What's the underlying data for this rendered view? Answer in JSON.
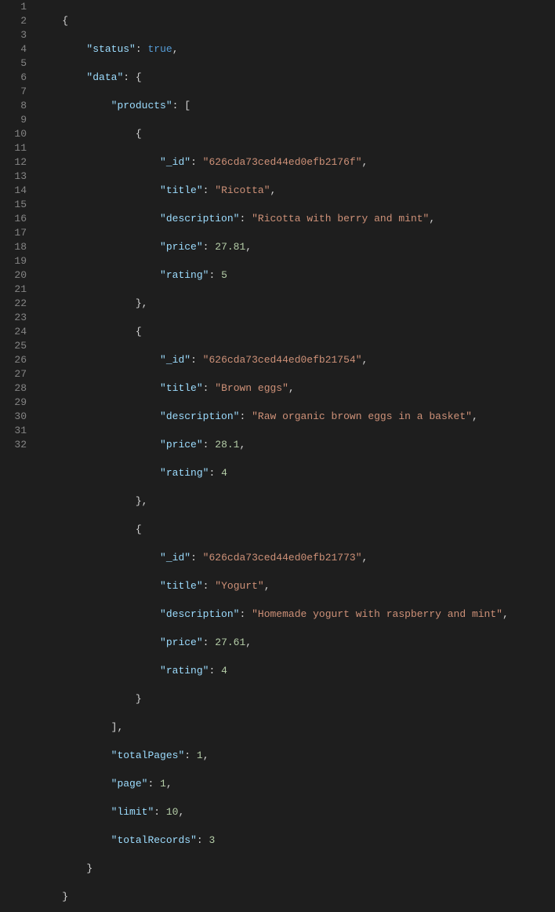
{
  "lineCount": 32,
  "keys": {
    "status": "status",
    "data": "data",
    "products": "products",
    "_id": "_id",
    "title": "title",
    "description": "description",
    "price": "price",
    "rating": "rating",
    "totalPages": "totalPages",
    "page": "page",
    "limit": "limit",
    "totalRecords": "totalRecords"
  },
  "values": {
    "status": "true",
    "totalPages": "1",
    "page": "1",
    "limit": "10",
    "totalRecords": "3"
  },
  "products": [
    {
      "_id": "626cda73ced44ed0efb2176f",
      "title": "Ricotta",
      "description": "Ricotta with berry and mint",
      "price": "27.81",
      "rating": "5"
    },
    {
      "_id": "626cda73ced44ed0efb21754",
      "title": "Brown eggs",
      "description": "Raw organic brown eggs in a basket",
      "price": "28.1",
      "rating": "4"
    },
    {
      "_id": "626cda73ced44ed0efb21773",
      "title": "Yogurt",
      "description": "Homemade yogurt with raspberry and mint",
      "price": "27.61",
      "rating": "4"
    }
  ]
}
